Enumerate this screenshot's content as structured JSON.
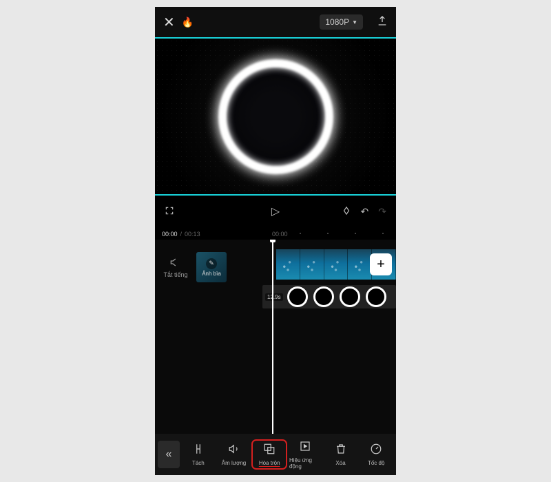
{
  "topbar": {
    "resolution_label": "1080P"
  },
  "ruler": {
    "current": "00:00",
    "total": "00:13",
    "tick2": "00:00"
  },
  "timeline": {
    "mute_label": "Tắt tiếng",
    "cover_label": "Ảnh bìa",
    "overlay_duration": "12.9s",
    "add_label": "+"
  },
  "tools": {
    "back": "«",
    "split": "Tách",
    "volume": "Âm lượng",
    "blend": "Hòa trộn",
    "effect": "Hiệu ứng động",
    "delete": "Xóa",
    "speed": "Tốc độ"
  }
}
